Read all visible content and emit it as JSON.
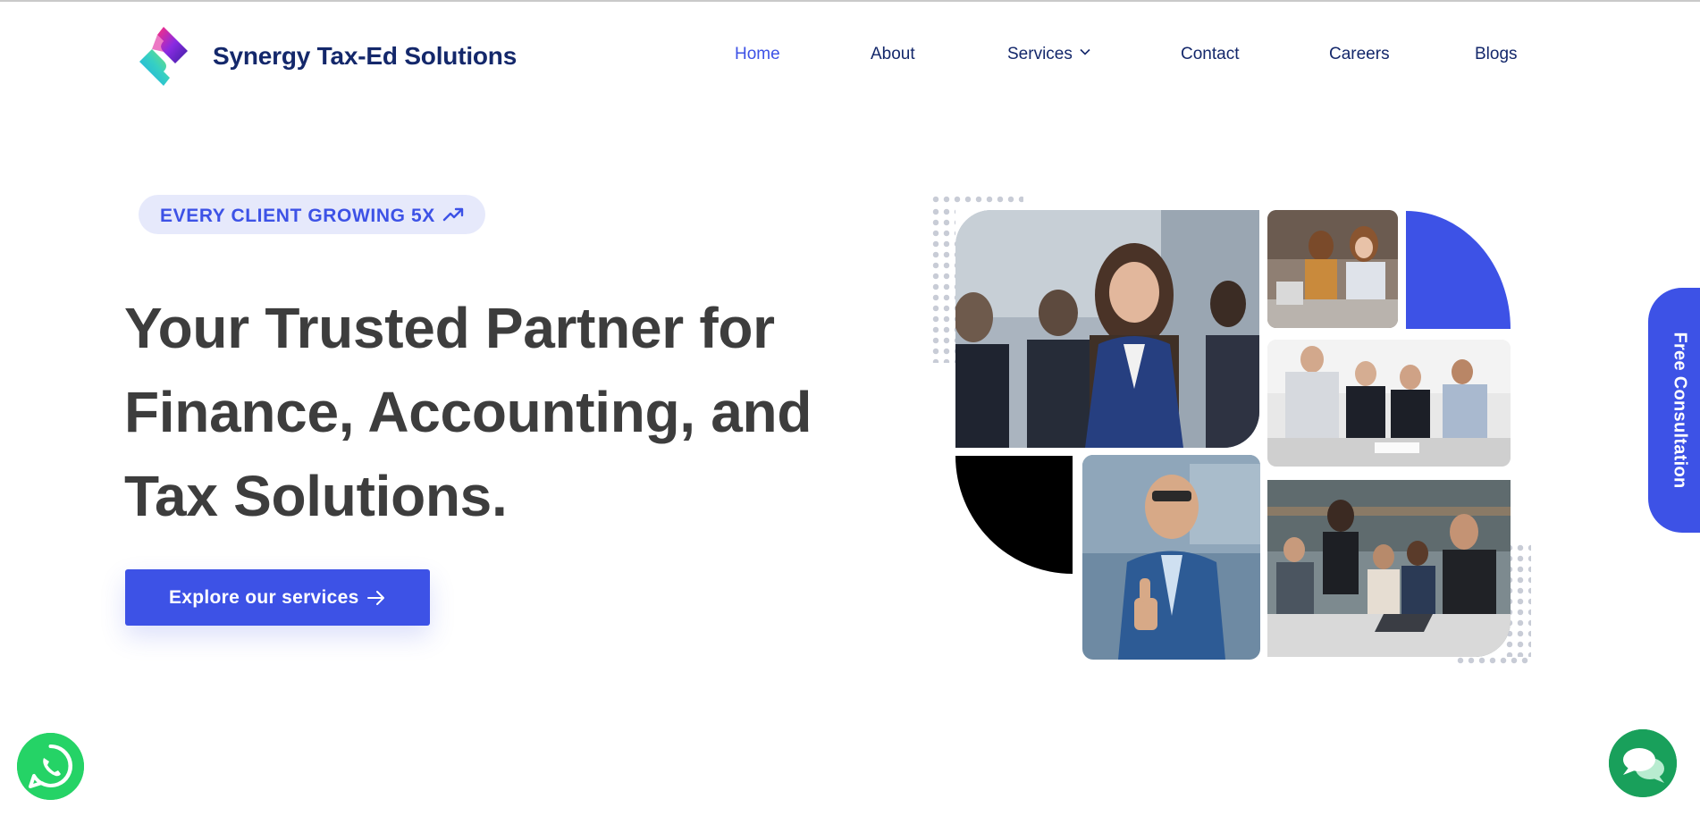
{
  "brand": {
    "name": "Synergy Tax-Ed Solutions",
    "logo_icon": "s-ribbon-logo-icon",
    "colors": {
      "primary": "#3d52e6",
      "navy": "#14286b",
      "headline": "#3d3d3d",
      "whatsapp": "#25d366",
      "chat": "#19a05b"
    }
  },
  "nav": {
    "items": [
      {
        "label": "Home",
        "active": true
      },
      {
        "label": "About"
      },
      {
        "label": "Services",
        "dropdown": true
      },
      {
        "label": "Contact"
      },
      {
        "label": "Careers"
      },
      {
        "label": "Blogs"
      }
    ]
  },
  "hero": {
    "badge": "EVERY CLIENT GROWING 5X",
    "badge_icon": "trending-up-icon",
    "headline_lines": [
      "Your Trusted Partner for",
      "Finance, Accounting, and",
      "Tax Solutions."
    ],
    "cta_label": "Explore our services",
    "cta_icon": "arrow-right-icon"
  },
  "side_tab": {
    "label": "Free Consultation"
  },
  "floating": {
    "whatsapp_icon": "whatsapp-icon",
    "chat_icon": "chat-bubbles-icon"
  },
  "collage": {
    "photos": [
      "businesswoman-portrait-photo",
      "call-center-agents-photo",
      "business-meeting-photo",
      "businessman-thumbs-up-photo",
      "team-laptop-meeting-photo"
    ]
  }
}
